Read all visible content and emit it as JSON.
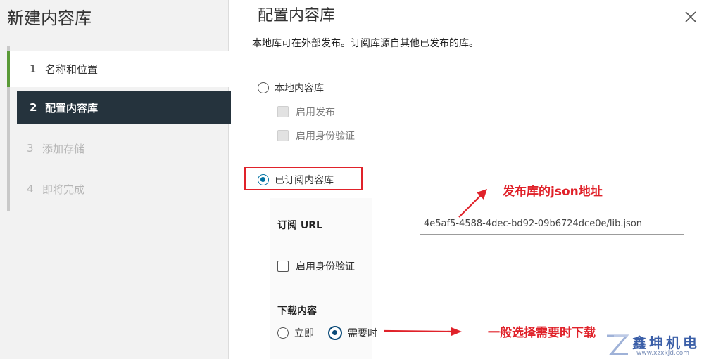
{
  "wizard": {
    "title": "新建内容库",
    "steps": [
      {
        "num": "1",
        "label": "名称和位置",
        "state": "done"
      },
      {
        "num": "2",
        "label": "配置内容库",
        "state": "active"
      },
      {
        "num": "3",
        "label": "添加存储",
        "state": "pending"
      },
      {
        "num": "4",
        "label": "即将完成",
        "state": "pending"
      }
    ]
  },
  "panel": {
    "title": "配置内容库",
    "description": "本地库可在外部发布。订阅库源自其他已发布的库。",
    "local_library": {
      "label": "本地内容库",
      "selected": false,
      "enable_publish": {
        "label": "启用发布",
        "checked": false,
        "disabled": true
      },
      "enable_auth": {
        "label": "启用身份验证",
        "checked": false,
        "disabled": true
      }
    },
    "subscribed_library": {
      "label": "已订阅内容库",
      "selected": true,
      "url_label": "订阅 URL",
      "url_value": "4e5af5-4588-4dec-bd92-09b6724dce0e/lib.json",
      "enable_auth": {
        "label": "启用身份验证",
        "checked": false
      },
      "download_label": "下载内容",
      "download_options": [
        {
          "label": "立即",
          "selected": false
        },
        {
          "label": "需要时",
          "selected": true
        }
      ]
    }
  },
  "annotations": {
    "url_note": "发布库的json地址",
    "download_note": "一般选择需要时下载",
    "color": "#e0222a"
  },
  "watermark": {
    "text": "鑫坤机电",
    "url": "www.xzxkjd.com"
  },
  "colors": {
    "sidebar_bg": "#f2f2f2",
    "active_step_bg": "#25333d",
    "done_step_accent": "#5a9a37",
    "radio_accent": "#0072a3"
  },
  "icons": {
    "close": "close-icon",
    "watermark_logo": "z-logo-icon"
  }
}
